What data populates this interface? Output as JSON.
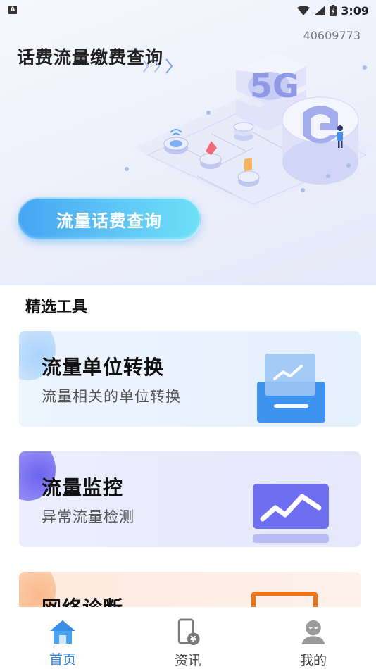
{
  "status_bar": {
    "left_badge": "A",
    "time": "3:09",
    "icons": [
      "wifi-icon",
      "signal-icon",
      "battery-icon"
    ]
  },
  "hero": {
    "code": "40609773",
    "title": "话费流量缴费查询",
    "button_label": "流量话费查询",
    "illustration_text": "5G"
  },
  "section": {
    "title": "精选工具"
  },
  "tools": [
    {
      "title": "流量单位转换",
      "subtitle": "流量相关的单位转换",
      "icon": "chart-tray-icon"
    },
    {
      "title": "流量监控",
      "subtitle": "异常流量检测",
      "icon": "trend-monitor-icon"
    },
    {
      "title": "网络诊断",
      "subtitle": "",
      "icon": "monitor-frame-icon"
    }
  ],
  "nav": {
    "items": [
      {
        "label": "首页",
        "icon": "home-icon",
        "active": true
      },
      {
        "label": "资讯",
        "icon": "phone-yen-icon",
        "active": false
      },
      {
        "label": "我的",
        "icon": "user-icon",
        "active": false
      }
    ]
  },
  "colors": {
    "accent_blue": "#2f7fde",
    "hero_button_start": "#45a5f3",
    "hero_button_end": "#6de0f6",
    "card_unit_bg": "#ecf4fe",
    "card_monitor_bg": "#ecedfd",
    "card_diag_bg": "#fde9df"
  }
}
